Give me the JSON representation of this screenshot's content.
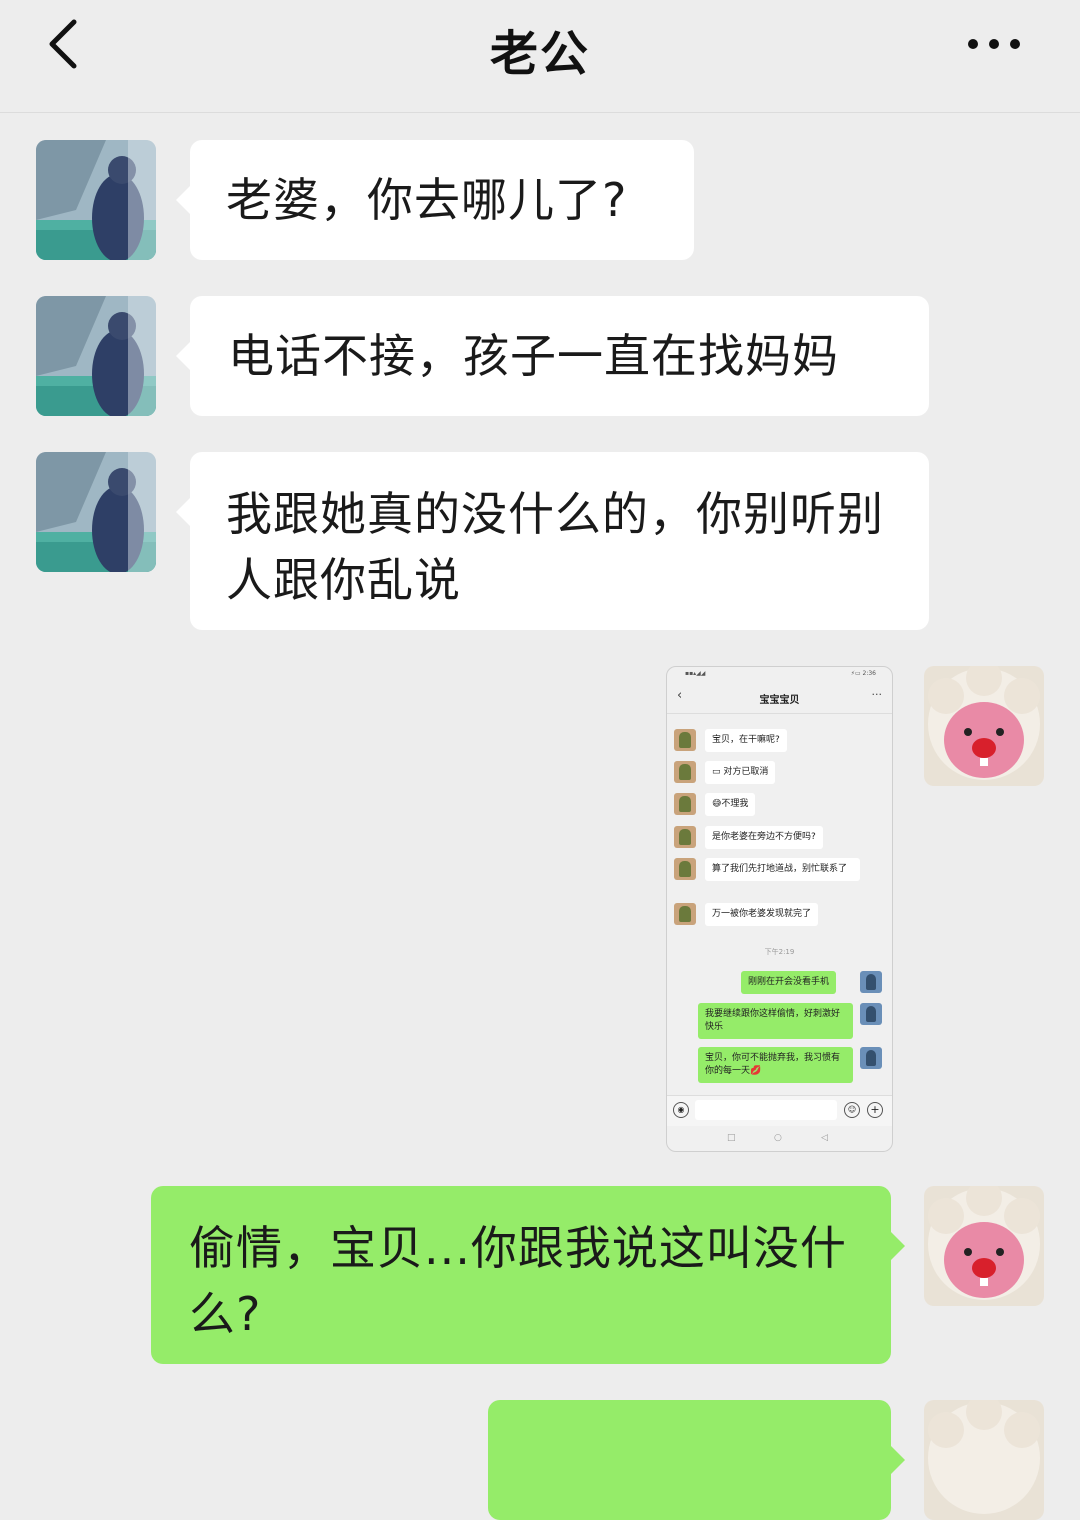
{
  "header": {
    "title": "老公"
  },
  "messages": [
    {
      "sender": "husband",
      "text": "老婆，你去哪儿了?"
    },
    {
      "sender": "husband",
      "text": "电话不接，孩子一直在找妈妈"
    },
    {
      "sender": "husband",
      "text": "我跟她真的没什么的，你别听别人跟你乱说"
    },
    {
      "sender": "me",
      "type": "image"
    },
    {
      "sender": "me",
      "text": "偷情，宝贝...你跟我说这叫没什么?"
    },
    {
      "sender": "me",
      "text": ""
    }
  ],
  "screenshot": {
    "status_signal": "▪▪▴◢◢",
    "status_right": "⚡▭ 2:36",
    "title": "宝宝宝贝",
    "time": "下午2:19",
    "messages": [
      {
        "sender": "other",
        "text": "宝贝，在干嘛呢?"
      },
      {
        "sender": "other",
        "text": "▭ 对方已取消"
      },
      {
        "sender": "other",
        "text": "😅不理我"
      },
      {
        "sender": "other",
        "text": "是你老婆在旁边不方便吗?"
      },
      {
        "sender": "other",
        "text": "算了我们先打地道战，别忙联系了"
      },
      {
        "sender": "other",
        "text": "万一被你老婆发现就完了"
      },
      {
        "sender": "self",
        "text": "刚刚在开会没看手机"
      },
      {
        "sender": "self",
        "text": "我要继续跟你这样偷情，好刺激好快乐"
      },
      {
        "sender": "self",
        "text": "宝贝，你可不能抛弃我，我习惯有你的每一天💋"
      }
    ]
  },
  "colors": {
    "background": "#ededed",
    "left_bubble": "#ffffff",
    "right_bubble": "#95ec69"
  },
  "icons": {
    "back": "chevron-left-icon",
    "more": "more-dots-icon"
  }
}
